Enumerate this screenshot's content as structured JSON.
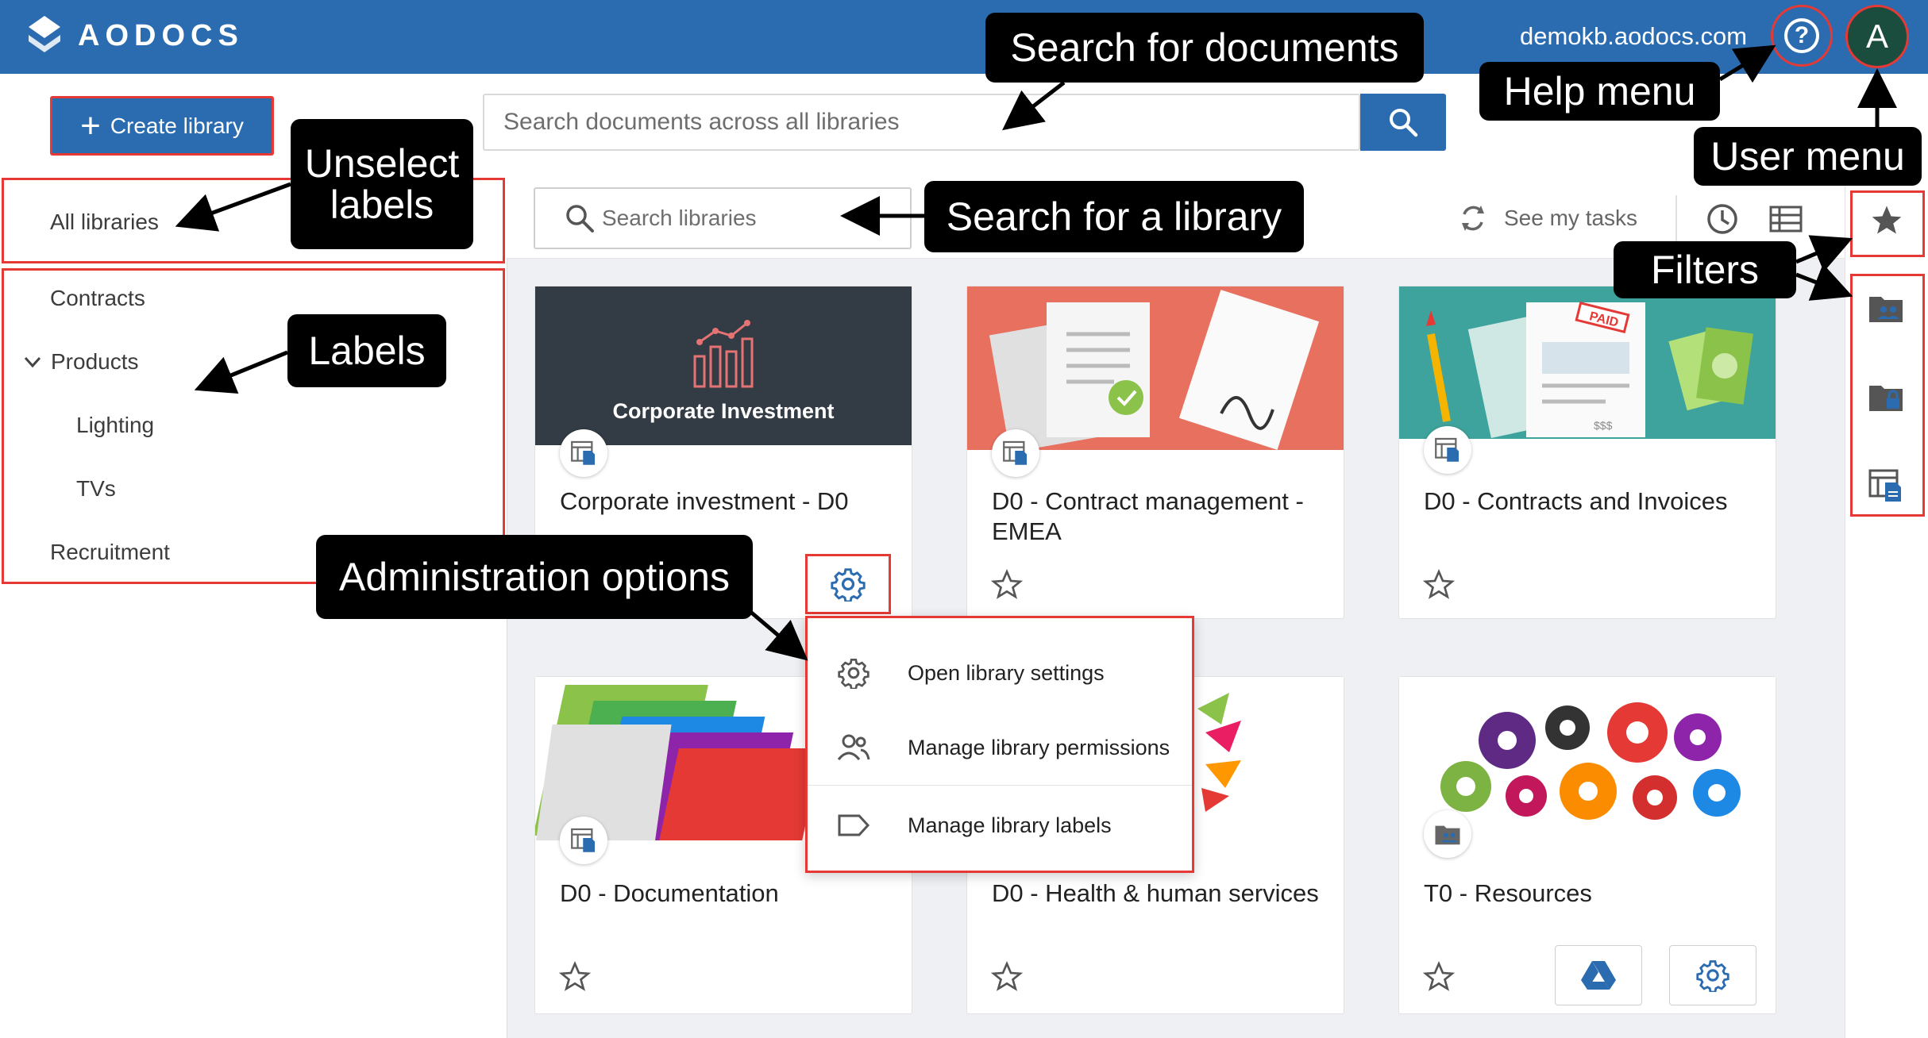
{
  "header": {
    "logo_text": "AODOCS",
    "domain": "demokb.aodocs.com",
    "help_glyph": "?",
    "user_initial": "A",
    "brand_color": "#2b6cb0"
  },
  "actions": {
    "create_library": "Create library"
  },
  "search": {
    "documents_placeholder": "Search documents across all libraries",
    "libraries_placeholder": "Search libraries"
  },
  "sidebar": {
    "all_libraries": "All libraries",
    "items": [
      {
        "label": "Contracts"
      },
      {
        "label": "Products"
      },
      {
        "label": "Lighting"
      },
      {
        "label": "TVs"
      },
      {
        "label": "Recruitment"
      }
    ]
  },
  "toolbar": {
    "see_my_tasks": "See my tasks"
  },
  "cards": [
    {
      "image_caption": "Corporate Investment",
      "title": "Corporate investment - D0"
    },
    {
      "title": "D0 - Contract management - EMEA"
    },
    {
      "image_stamp": "PAID",
      "image_amount": "$$$",
      "title": "D0 - Contracts and Invoices"
    },
    {
      "title": "D0 - Documentation"
    },
    {
      "title": "D0 - Health & human services"
    },
    {
      "title": "T0 - Resources"
    }
  ],
  "menu": {
    "items": [
      {
        "label": "Open library settings",
        "icon": "gear-icon"
      },
      {
        "label": "Manage library permissions",
        "icon": "people-icon"
      },
      {
        "label": "Manage library labels",
        "icon": "label-icon"
      }
    ]
  },
  "callouts": {
    "search_documents": "Search for documents",
    "help_menu": "Help menu",
    "user_menu": "User menu",
    "unselect_labels": "Unselect labels",
    "labels": "Labels",
    "search_library": "Search for a library",
    "filters": "Filters",
    "admin_options": "Administration options"
  },
  "colors": {
    "highlight": "#e53935",
    "accent": "#2b6cb0",
    "callout_bg": "#000000"
  }
}
